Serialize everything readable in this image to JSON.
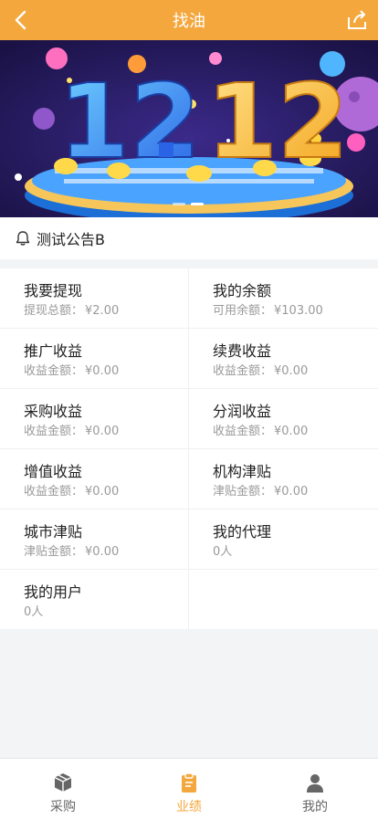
{
  "header": {
    "title": "找油"
  },
  "notice": {
    "text": "测试公告B"
  },
  "grid": {
    "rows": [
      [
        {
          "name": "我要提现",
          "label": "提现总额：",
          "amount": "¥2.00"
        },
        {
          "name": "我的余额",
          "label": "可用余额：",
          "amount": "¥103.00"
        }
      ],
      [
        {
          "name": "推广收益",
          "label": "收益金额：",
          "amount": "¥0.00"
        },
        {
          "name": "续费收益",
          "label": "收益金额：",
          "amount": "¥0.00"
        }
      ],
      [
        {
          "name": "采购收益",
          "label": "收益金额：",
          "amount": "¥0.00"
        },
        {
          "name": "分润收益",
          "label": "收益金额：",
          "amount": "¥0.00"
        }
      ],
      [
        {
          "name": "增值收益",
          "label": "收益金额：",
          "amount": "¥0.00"
        },
        {
          "name": "机构津贴",
          "label": "津贴金额：",
          "amount": "¥0.00"
        }
      ],
      [
        {
          "name": "城市津贴",
          "label": "津贴金额：",
          "amount": "¥0.00"
        },
        {
          "name": "我的代理",
          "label": "0人",
          "amount": ""
        }
      ],
      [
        {
          "name": "我的用户",
          "label": "0人",
          "amount": ""
        },
        {
          "name": "",
          "label": "",
          "amount": ""
        }
      ]
    ]
  },
  "tabbar": {
    "tabs": [
      {
        "label": "采购",
        "icon": "box-icon",
        "active": false
      },
      {
        "label": "业绩",
        "icon": "clipboard-icon",
        "active": true
      },
      {
        "label": "我的",
        "icon": "person-icon",
        "active": false
      }
    ]
  },
  "colors": {
    "accent": "#f4a73c",
    "banner_bg": "#2b1d6b"
  },
  "banner": {
    "alt_text": "12.12"
  }
}
